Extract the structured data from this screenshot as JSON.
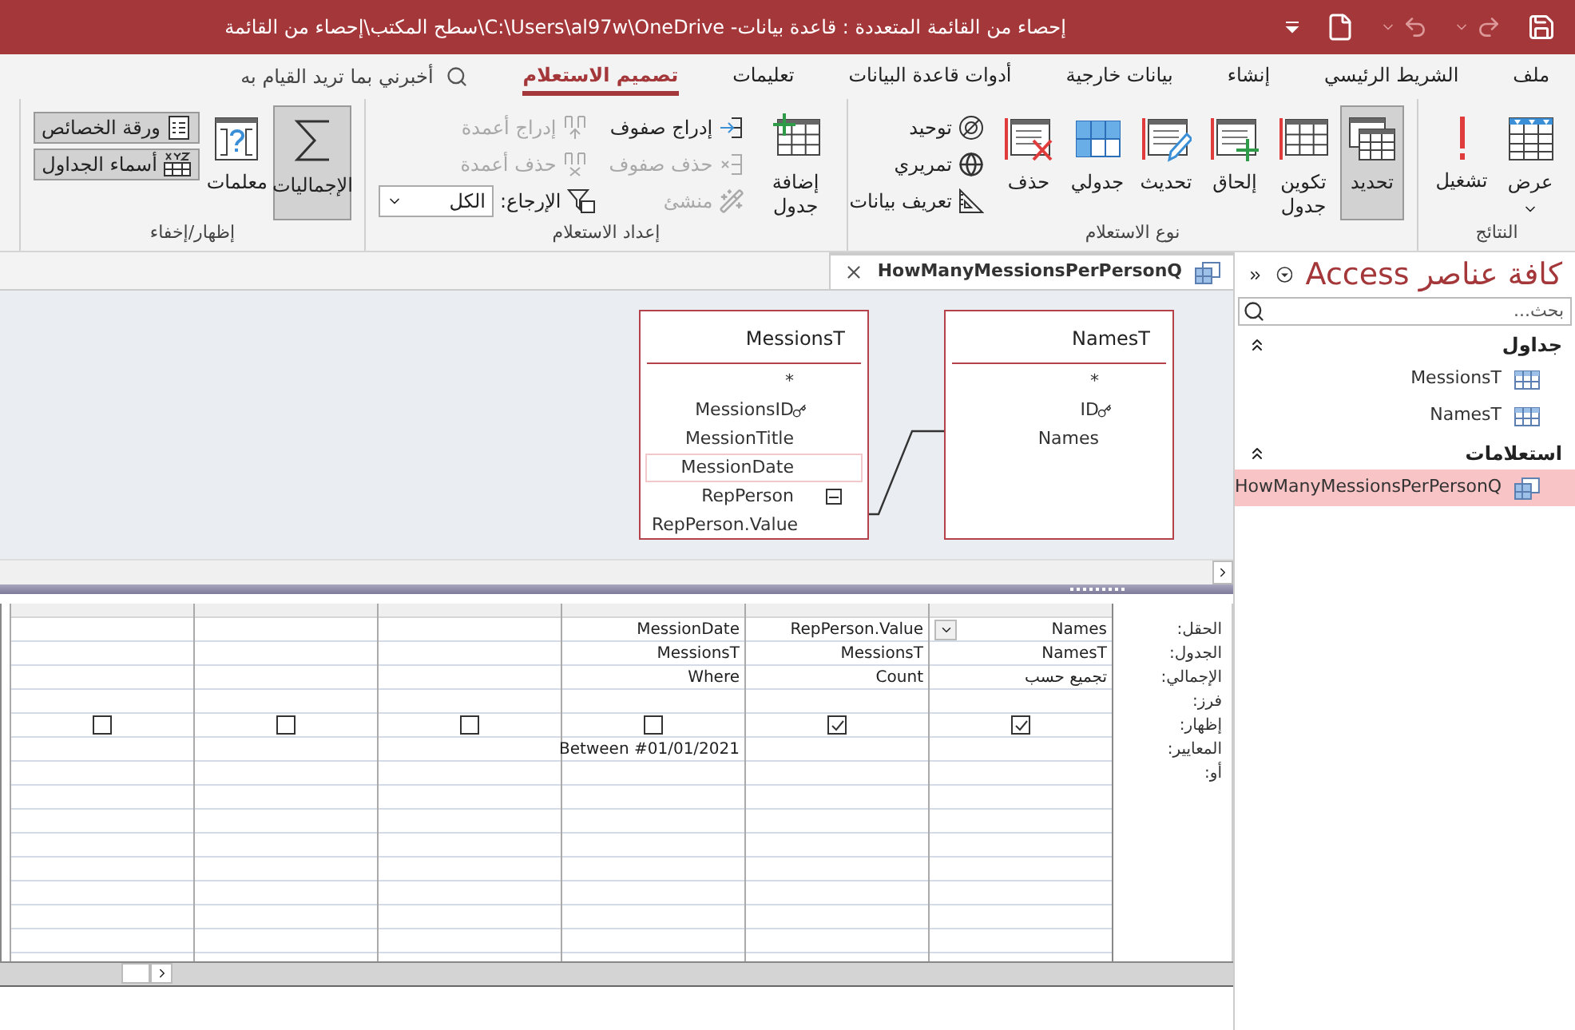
{
  "title_bar": {
    "title": "إحصاء من القائمة المتعددة : قاعدة بيانات- C:\\Users\\al97w\\OneDrive\\سطح المكتب\\إحصاء من القائمة"
  },
  "ribbon_tabs": [
    {
      "label": "ملف",
      "selected": false
    },
    {
      "label": "الشريط الرئيسي",
      "selected": false
    },
    {
      "label": "إنشاء",
      "selected": false
    },
    {
      "label": "بيانات خارجية",
      "selected": false
    },
    {
      "label": "أدوات قاعدة البيانات",
      "selected": false
    },
    {
      "label": "تعليمات",
      "selected": false
    },
    {
      "label": "تصميم الاستعلام",
      "selected": true
    }
  ],
  "tell_me": {
    "placeholder": "أخبرني بما تريد القيام به"
  },
  "ribbon_groups": [
    {
      "label": "النتائج",
      "items": [
        {
          "kind": "large",
          "label": "عرض",
          "menu": true,
          "selected": false
        },
        {
          "kind": "large",
          "label": "تشغيل",
          "menu": false,
          "selected": false
        }
      ]
    },
    {
      "label": "نوع الاستعلام",
      "items": [
        {
          "kind": "large",
          "label": "تحديد",
          "menu": false,
          "selected": true
        },
        {
          "kind": "large",
          "label": "تكوين جدول",
          "menu": false,
          "selected": false
        },
        {
          "kind": "large",
          "label": "إلحاق",
          "menu": false,
          "selected": false
        },
        {
          "kind": "large",
          "label": "تحديث",
          "menu": false,
          "selected": false
        },
        {
          "kind": "large",
          "label": "جدولي",
          "menu": false,
          "selected": false
        },
        {
          "kind": "large",
          "label": "حذف",
          "menu": false,
          "selected": false
        },
        {
          "kind": "stack",
          "items": [
            {
              "kind": "button",
              "label": "توحيد",
              "disabled": false,
              "selected": false
            },
            {
              "kind": "button",
              "label": "تمريري",
              "disabled": false,
              "selected": false
            },
            {
              "kind": "button",
              "label": "تعريف بيانات",
              "disabled": false,
              "selected": false
            }
          ]
        }
      ]
    },
    {
      "label": "إعداد الاستعلام",
      "items": [
        {
          "kind": "large",
          "label": "إضافة جدول",
          "menu": false,
          "selected": false
        },
        {
          "kind": "stack",
          "items": [
            {
              "kind": "button",
              "label": "إدراج صفوف",
              "disabled": false,
              "selected": false
            },
            {
              "kind": "button",
              "label": "حذف صفوف",
              "disabled": true,
              "selected": false
            },
            {
              "kind": "button",
              "label": "منشئ",
              "disabled": true,
              "selected": false
            }
          ]
        },
        {
          "kind": "stack",
          "items": [
            {
              "kind": "button",
              "label": "إدراج أعمدة",
              "disabled": true,
              "selected": false
            },
            {
              "kind": "button",
              "label": "حذف أعمدة",
              "disabled": true,
              "selected": false
            },
            {
              "kind": "combo",
              "label": "الإرجاع:",
              "value": "الكل"
            }
          ]
        }
      ]
    },
    {
      "label": "إظهار/إخفاء",
      "items": [
        {
          "kind": "large",
          "label": "الإجماليات",
          "menu": false,
          "selected": true
        },
        {
          "kind": "large",
          "label": "معلمات",
          "menu": false,
          "selected": false
        },
        {
          "kind": "stack",
          "items": [
            {
              "kind": "button",
              "label": "ورقة الخصائص",
              "disabled": false,
              "selected": true
            },
            {
              "kind": "button",
              "label": "أسماء الجداول",
              "disabled": false,
              "selected": true
            }
          ]
        }
      ]
    }
  ],
  "document_tab": {
    "label": "HowManyMessionsPerPersonQ"
  },
  "tables": [
    {
      "name": "NamesT",
      "fields": [
        {
          "label": "*",
          "kind": "all",
          "primary_key": false,
          "selected": false
        },
        {
          "label": "ID",
          "kind": "field",
          "primary_key": true,
          "selected": false
        },
        {
          "label": "Names",
          "kind": "field",
          "primary_key": false,
          "selected": false
        }
      ]
    },
    {
      "name": "MessionsT",
      "fields": [
        {
          "label": "*",
          "kind": "all",
          "primary_key": false,
          "selected": false
        },
        {
          "label": "MessionsID",
          "kind": "field",
          "primary_key": true,
          "selected": false
        },
        {
          "label": "MessionTitle",
          "kind": "field",
          "primary_key": false,
          "selected": false
        },
        {
          "label": "MessionDate",
          "kind": "field",
          "primary_key": false,
          "selected": true
        },
        {
          "label": "RepPerson",
          "kind": "multivalue",
          "primary_key": false,
          "selected": false,
          "expanded": true
        },
        {
          "label": "RepPerson.Value",
          "kind": "subfield",
          "primary_key": false,
          "selected": false
        }
      ]
    }
  ],
  "grid": {
    "row_labels": [
      "الحقل:",
      "الجدول:",
      "الإجمالي:",
      "فرز:",
      "إظهار:",
      "المعايير:",
      "أو:"
    ],
    "columns": [
      {
        "field": "Names",
        "table": "NamesT",
        "total": "تجميع حسب",
        "show": true,
        "selected": true
      },
      {
        "field": "RepPerson.Value",
        "table": "MessionsT",
        "total": "Count",
        "show": true,
        "selected": false
      },
      {
        "field": "MessionDate",
        "table": "MessionsT",
        "total": "Where",
        "show": false,
        "criteria": "Between #01/01/2021",
        "selected": false
      },
      {
        "show": false,
        "selected": false
      },
      {
        "show": false,
        "selected": false
      },
      {
        "show": false,
        "selected": false
      }
    ]
  },
  "nav_pane": {
    "title": "كافة عناصر Access",
    "search": {
      "placeholder": "بحث..."
    },
    "groups": [
      {
        "label": "جداول",
        "expanded": true,
        "items": [
          {
            "label": "MessionsT",
            "selected": false
          },
          {
            "label": "NamesT",
            "selected": false
          }
        ]
      },
      {
        "label": "استعلامات",
        "expanded": true,
        "items": [
          {
            "label": "HowManyMessionsPerPersonQ",
            "selected": true
          }
        ]
      }
    ]
  }
}
